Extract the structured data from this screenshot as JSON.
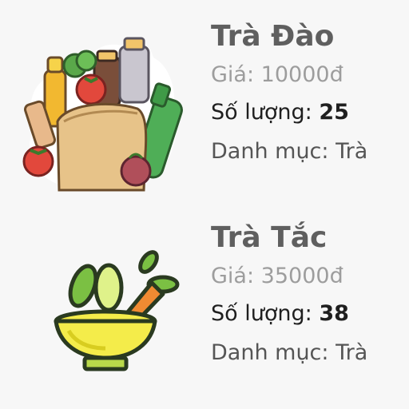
{
  "products": [
    {
      "name": "Trà Đào",
      "price_label": "Giá:",
      "price": "10000đ",
      "qty_label": "Số lượng:",
      "qty": "25",
      "category_label": "Danh mục:",
      "category": "Trà",
      "icon": "grocery-bag-icon"
    },
    {
      "name": "Trà Tắc",
      "price_label": "Giá:",
      "price": "35000đ",
      "qty_label": "Số lượng:",
      "qty": "38",
      "category_label": "Danh mục:",
      "category": "Trà",
      "icon": "vegetable-bowl-icon"
    }
  ],
  "colors": {
    "background": "#f7f7f7",
    "name": "#5f5f5f",
    "price": "#9d9d9d",
    "qty": "#1f1f1f",
    "category": "#555555"
  }
}
